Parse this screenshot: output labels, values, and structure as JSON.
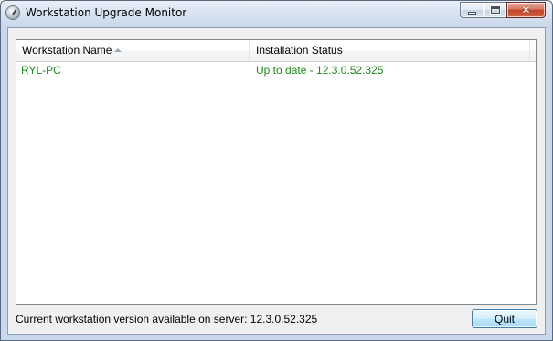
{
  "window": {
    "title": "Workstation Upgrade Monitor",
    "icon": "monitor-gauge-icon",
    "controls": {
      "minimize_icon": "minimize-icon",
      "maximize_icon": "maximize-icon",
      "close_icon": "close-icon"
    }
  },
  "list": {
    "columns": [
      {
        "label": "Workstation Name",
        "sort": "ascending"
      },
      {
        "label": "Installation Status"
      }
    ],
    "rows": [
      {
        "name": "RYL-PC",
        "status": "Up to date - 12.3.0.52.325"
      }
    ],
    "row_text_color": "#1a8a1a"
  },
  "footer": {
    "version_label": "Current workstation version available on server:  12.3.0.52.325",
    "quit_label": "Quit"
  }
}
